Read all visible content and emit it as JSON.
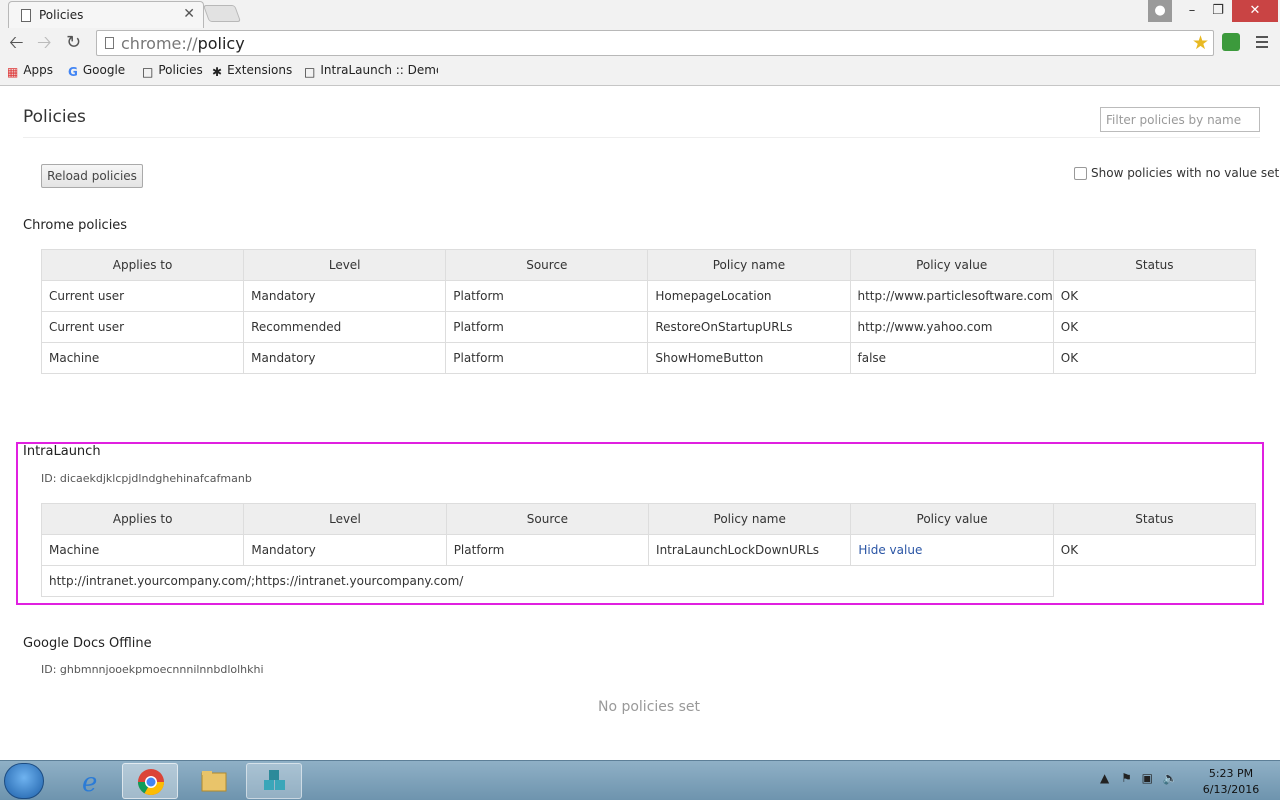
{
  "tab": {
    "title": "Policies",
    "close": "✕"
  },
  "window": {
    "user_icon": "user-icon",
    "minimize": "–",
    "maximize": "❐",
    "close": "✕"
  },
  "omnibox": {
    "scheme": "chrome://",
    "path": "policy"
  },
  "bookmarks": [
    {
      "label": "Apps",
      "icon": "apps-grid-icon"
    },
    {
      "label": "Google",
      "icon": "google-g-icon"
    },
    {
      "label": "Policies",
      "icon": "page-icon"
    },
    {
      "label": "Extensions",
      "icon": "puzzle-icon"
    },
    {
      "label": "IntraLaunch :: Demons",
      "icon": "page-icon"
    }
  ],
  "page": {
    "title": "Policies",
    "filter_placeholder": "Filter policies by name",
    "reload_label": "Reload policies",
    "show_novalue_label": "Show policies with no value set"
  },
  "columns": [
    "Applies to",
    "Level",
    "Source",
    "Policy name",
    "Policy value",
    "Status"
  ],
  "chrome_policies": {
    "heading": "Chrome policies",
    "rows": [
      [
        "Current user",
        "Mandatory",
        "Platform",
        "HomepageLocation",
        "http://www.particlesoftware.com",
        "OK"
      ],
      [
        "Current user",
        "Recommended",
        "Platform",
        "RestoreOnStartupURLs",
        "http://www.yahoo.com",
        "OK"
      ],
      [
        "Machine",
        "Mandatory",
        "Platform",
        "ShowHomeButton",
        "false",
        "OK"
      ]
    ]
  },
  "intralaunch": {
    "heading": "IntraLaunch",
    "id": "ID: dicaekdjklcpjdlndghehinafcafmanb",
    "row": [
      "Machine",
      "Mandatory",
      "Platform",
      "IntraLaunchLockDownURLs",
      "Hide value",
      "OK"
    ],
    "expanded_value": "http://intranet.yourcompany.com/;https://intranet.yourcompany.com/",
    "highlight_color": "#e020e0"
  },
  "google_docs": {
    "heading": "Google Docs Offline",
    "id": "ID: ghbmnnjooekpmoecnnnilnnbdlolhkhi",
    "empty": "No policies set"
  },
  "taskbar": {
    "time": "5:23 PM",
    "date": "6/13/2016"
  }
}
